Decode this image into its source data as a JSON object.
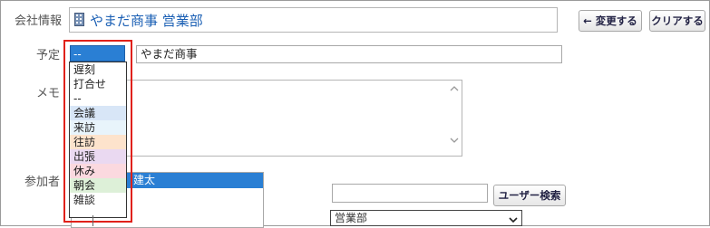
{
  "labels": {
    "company": "会社情報",
    "schedule": "予定",
    "memo": "メモ",
    "participants": "参加者"
  },
  "company": {
    "value": "やまだ商事 営業部"
  },
  "buttons": {
    "change": "← 変更する",
    "clear": "クリアする",
    "user_search": "ユーザー検索"
  },
  "schedule": {
    "selected": "--",
    "title_value": "やまだ商事"
  },
  "menu_options": [
    {
      "label": "遅刻",
      "color": "#ffffff"
    },
    {
      "label": "打合せ",
      "color": "#ffffff"
    },
    {
      "label": "--",
      "color": "#ffffff"
    },
    {
      "label": "会議",
      "color": "#d8e6f7"
    },
    {
      "label": "来訪",
      "color": "#e8f4fb"
    },
    {
      "label": "往訪",
      "color": "#fde3cc"
    },
    {
      "label": "出張",
      "color": "#ead9f1"
    },
    {
      "label": "休み",
      "color": "#fbd9df"
    },
    {
      "label": "朝会",
      "color": "#ddf0d8"
    },
    {
      "label": "雑談",
      "color": "#ffffff"
    }
  ],
  "participants": {
    "selected_member_suffix": "建太",
    "search_value": ""
  },
  "department_select": {
    "value": "営業部"
  },
  "colors": {
    "accent": "#2a7fd4",
    "highlight": "#e0211a",
    "link": "#1a5fb4"
  }
}
